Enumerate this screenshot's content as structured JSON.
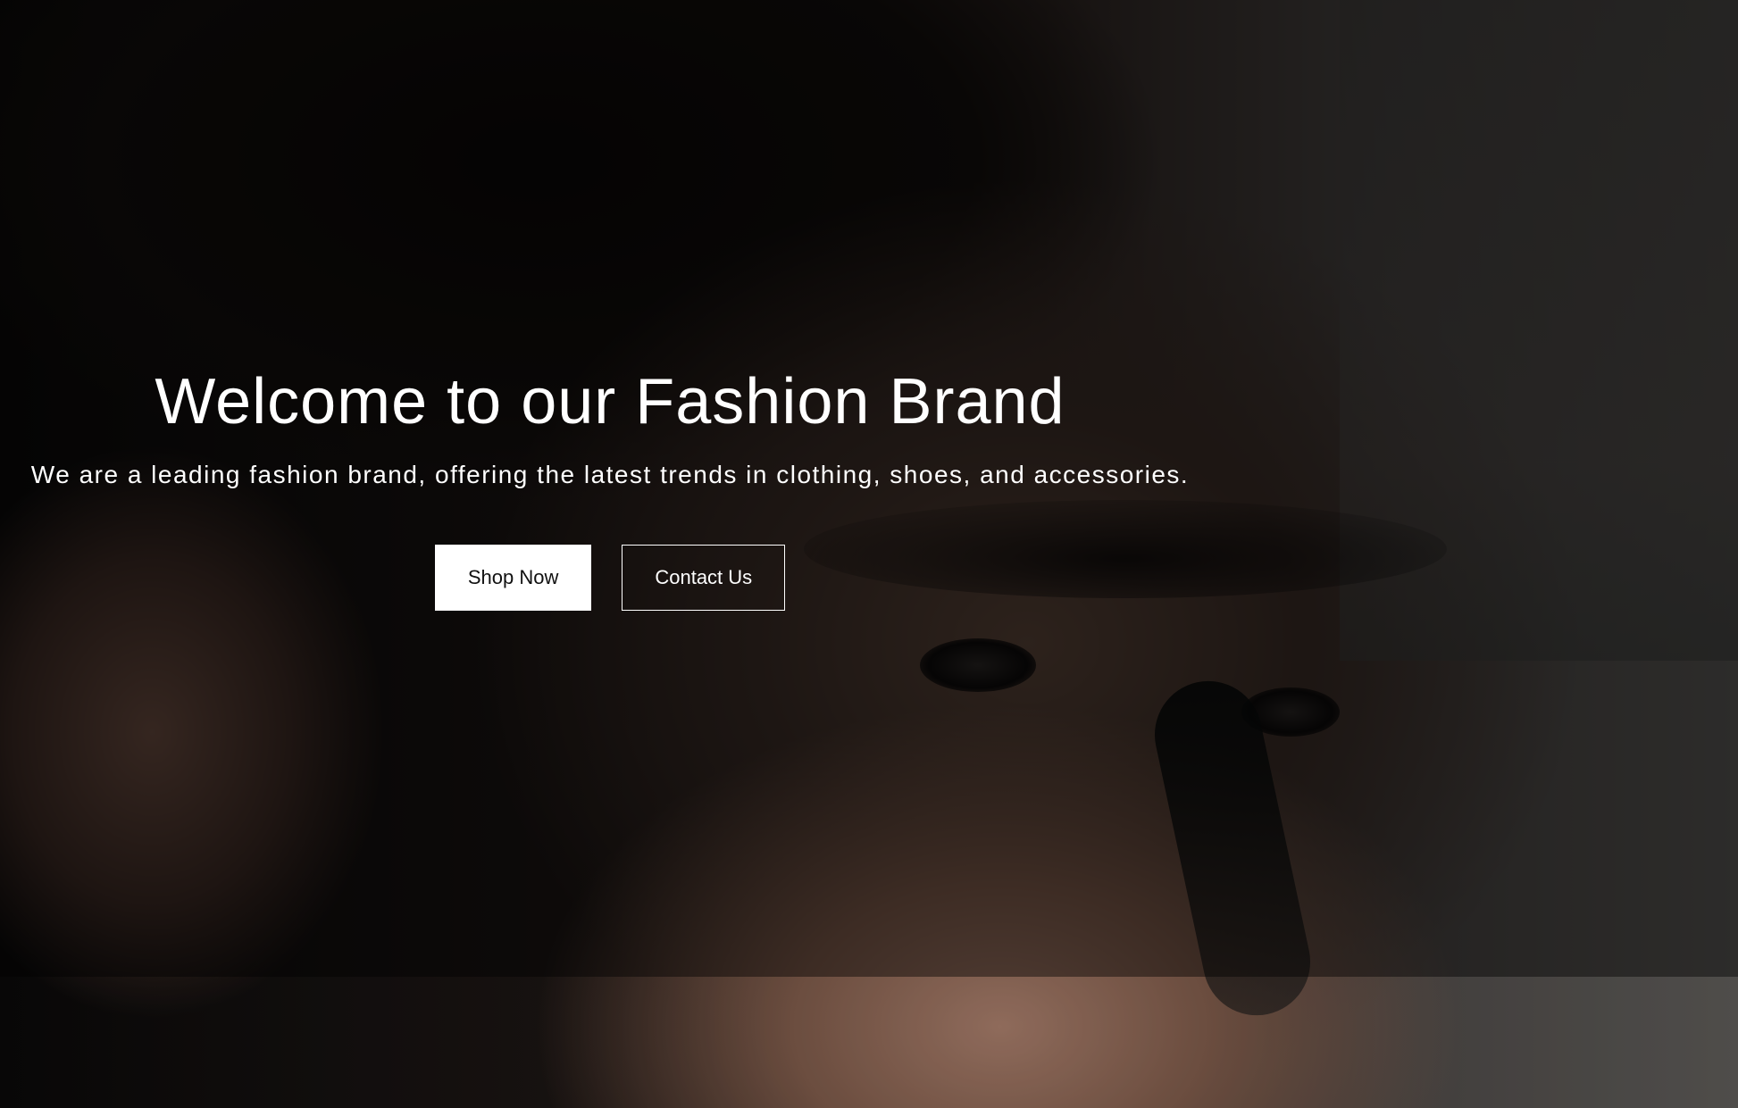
{
  "hero": {
    "title": "Welcome to our Fashion Brand",
    "subtitle": "We are a leading fashion brand, offering the latest trends in clothing, shoes, and accessories.",
    "primary_button_label": "Shop Now",
    "secondary_button_label": "Contact Us",
    "background_image": "portrait-photo"
  },
  "colors": {
    "text": "#ffffff",
    "primary_button_bg": "#ffffff",
    "primary_button_text": "#111111",
    "overlay": "rgba(0,0,0,0.5)"
  }
}
